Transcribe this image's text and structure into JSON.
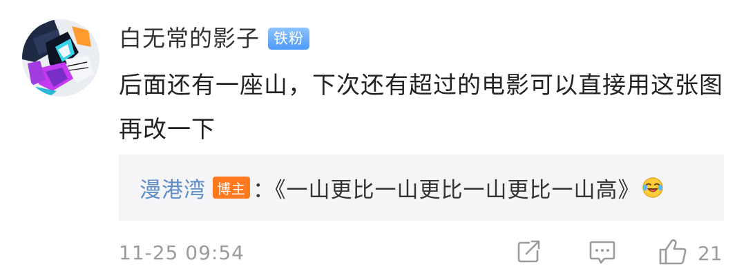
{
  "comment": {
    "username": "白无常的影子",
    "fan_badge": "铁粉",
    "content": "后面还有一座山，下次还有超过的电影可以直接用这张图再改一下",
    "reply": {
      "author": "漫港湾",
      "owner_badge": "博主",
      "text": "：《一山更比一山更比一山更比一山高》",
      "emoji": "laugh-cry-icon"
    },
    "timestamp": "11-25 09:54",
    "actions": {
      "share_icon": "share-icon",
      "reply_icon": "comment-icon",
      "like_icon": "thumbs-up-icon",
      "like_count": "21"
    }
  },
  "colors": {
    "username": "#333333",
    "fan_badge": "#5aa4f7",
    "reply_author": "#5e8dc8",
    "owner_badge": "#ff7a1f",
    "reply_bg": "#f5f5f7",
    "meta": "#9b9b9b"
  }
}
